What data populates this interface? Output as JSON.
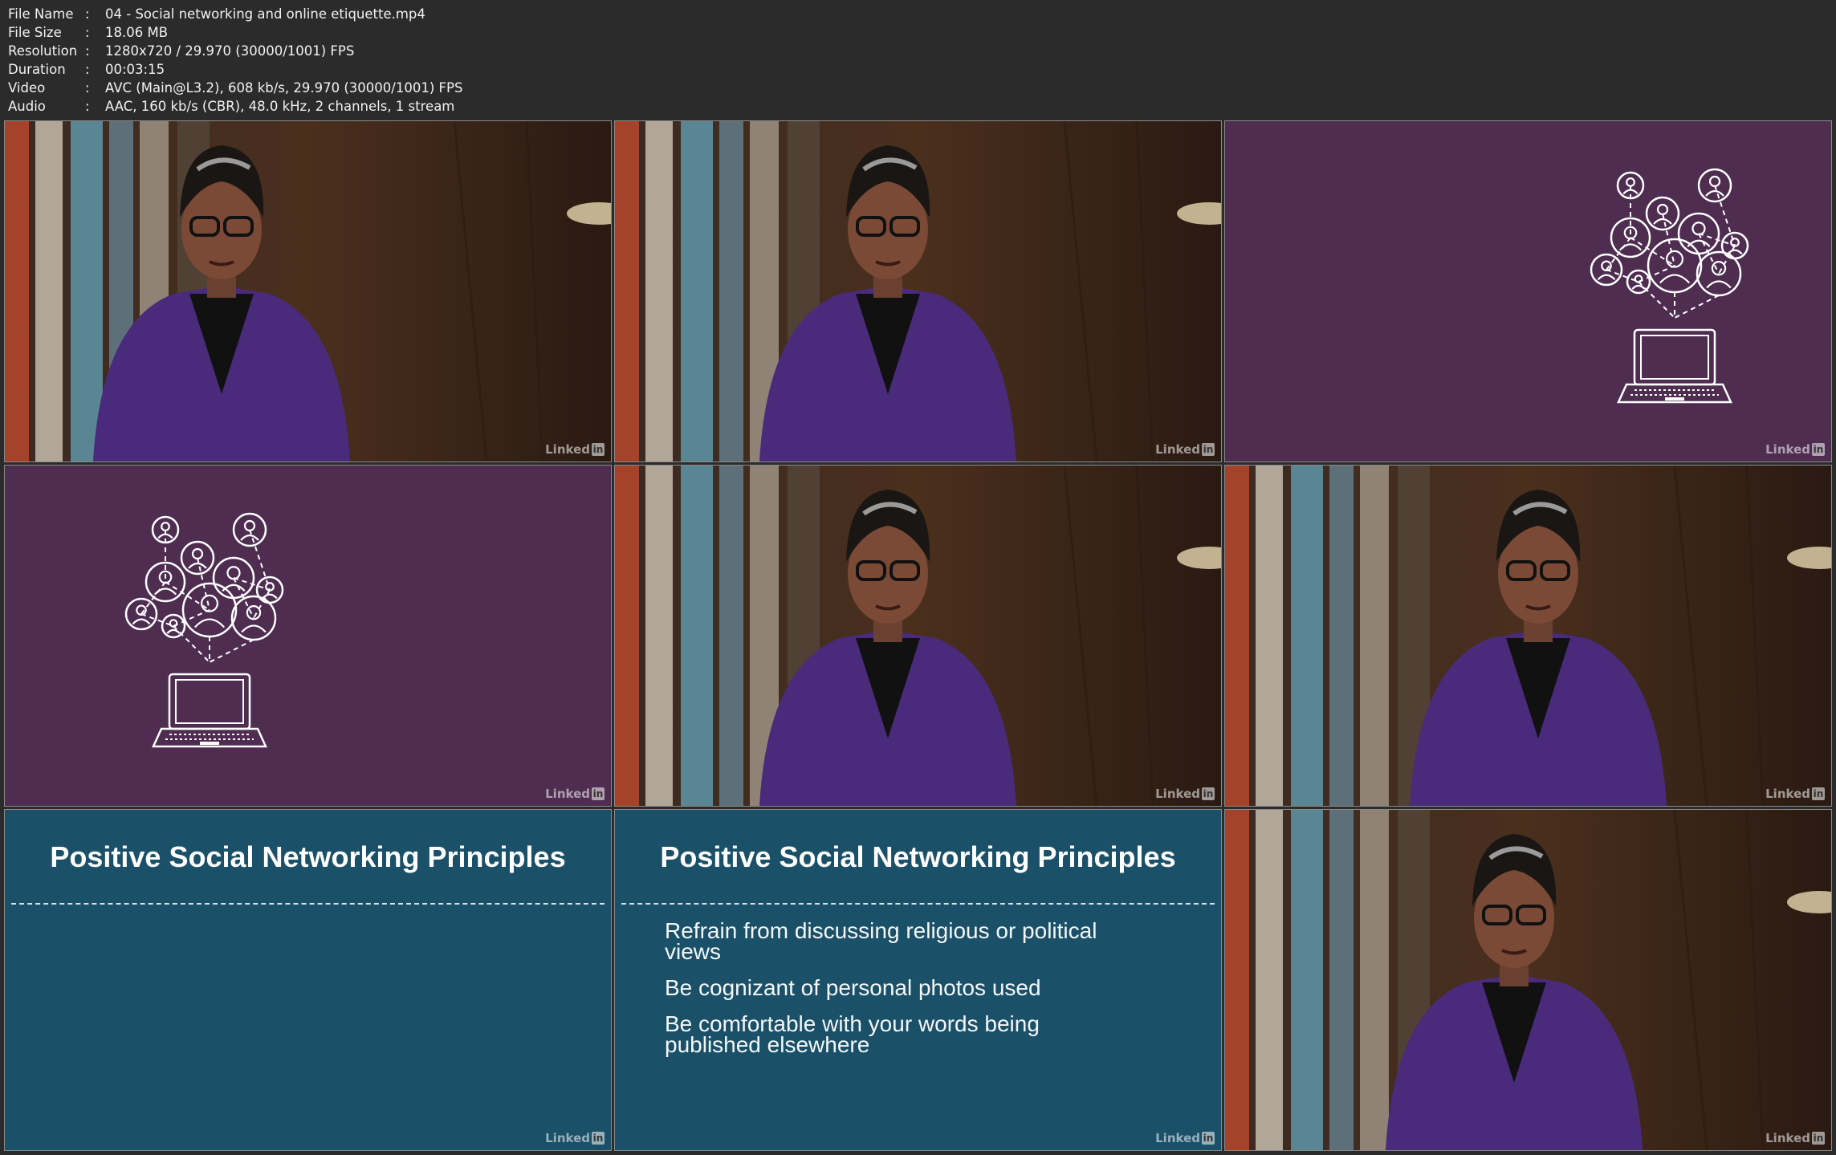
{
  "metadata": [
    {
      "key": "File Name",
      "value": "04 - Social networking and online etiquette.mp4"
    },
    {
      "key": "File Size",
      "value": "18.06 MB"
    },
    {
      "key": "Resolution",
      "value": "1280x720 / 29.970 (30000/1001) FPS"
    },
    {
      "key": "Duration",
      "value": "00:03:15"
    },
    {
      "key": "Video",
      "value": "AVC (Main@L3.2), 608 kb/s, 29.970 (30000/1001) FPS"
    },
    {
      "key": "Audio",
      "value": "AAC, 160 kb/s (CBR), 48.0 kHz, 2 channels, 1 stream"
    }
  ],
  "separator": ":",
  "watermark": {
    "text": "Linked",
    "badge": "in"
  },
  "slides": {
    "title": "Positive Social Networking Principles",
    "bullets": [
      "Refrain from discussing religious or political views",
      "Be cognizant of personal photos used",
      "Be comfortable with your words being published elsewhere"
    ]
  },
  "thumbnails": [
    "presenter",
    "presenter",
    "network",
    "network",
    "presenter",
    "presenter",
    "slide-title",
    "slide-bullets",
    "presenter"
  ],
  "colors": {
    "background": "#2b2b2b",
    "network_bg": "#4e2d51",
    "slide_bg": "#1a5068",
    "jacket": "#4a2a7a"
  }
}
